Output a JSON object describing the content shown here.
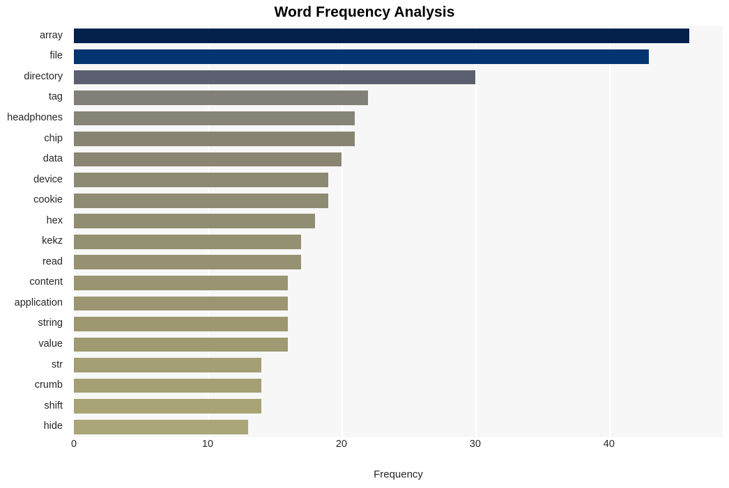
{
  "chart_data": {
    "type": "bar",
    "orientation": "horizontal",
    "title": "Word Frequency Analysis",
    "xlabel": "Frequency",
    "ylabel": "",
    "categories": [
      "array",
      "file",
      "directory",
      "tag",
      "headphones",
      "chip",
      "data",
      "device",
      "cookie",
      "hex",
      "kekz",
      "read",
      "content",
      "application",
      "string",
      "value",
      "str",
      "crumb",
      "shift",
      "hide"
    ],
    "values": [
      46,
      43,
      30,
      22,
      21,
      21,
      20,
      19,
      19,
      18,
      17,
      17,
      16,
      16,
      16,
      16,
      14,
      14,
      14,
      13
    ],
    "xlim": [
      0,
      48.5
    ],
    "xticks": [
      0,
      10,
      20,
      30,
      40
    ],
    "xtick_labels": [
      "0",
      "10",
      "20",
      "30",
      "40"
    ],
    "grid": true,
    "grid_color": "#ffffff",
    "plot_background": "#f7f7f7",
    "figure_background": "#ffffff",
    "legend": null,
    "bar_colors": [
      "#03214b",
      "#043570",
      "#5b5f70",
      "#817f77",
      "#868377",
      "#888474",
      "#8a8673",
      "#8d8972",
      "#8f8b72",
      "#918d72",
      "#949072",
      "#969271",
      "#999471",
      "#9b9671",
      "#9d9871",
      "#9f9a72",
      "#a39e73",
      "#a5a074",
      "#a8a375",
      "#aba677"
    ]
  },
  "axis": {
    "x_label": "Frequency"
  }
}
